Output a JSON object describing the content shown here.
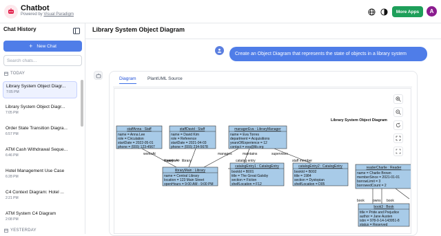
{
  "header": {
    "title": "Chatbot",
    "powered_prefix": "Powered by",
    "powered_brand": "Visual Paradigm",
    "more_apps": "More Apps",
    "avatar_letter": "A"
  },
  "sidebar": {
    "title": "Chat History",
    "new_chat": "New Chat",
    "search_placeholder": "Search chats...",
    "today_label": "TODAY",
    "yesterday_label": "YESTERDAY",
    "chats": [
      {
        "title": "Library System Object Diagr...",
        "time": "7:05 PM"
      },
      {
        "title": "Library System Object Diagr...",
        "time": "7:05 PM"
      },
      {
        "title": "Order State Transition Diagra...",
        "time": "6:57 PM"
      },
      {
        "title": "ATM Cash Withdrawal Seque...",
        "time": "6:46 PM"
      },
      {
        "title": "Hotel Management Use Case",
        "time": "6:28 PM"
      },
      {
        "title": "C4 Context Diagram: Hotel ...",
        "time": "2:21 PM"
      },
      {
        "title": "ATM System C4 Diagram",
        "time": "2:08 PM"
      }
    ]
  },
  "main": {
    "title": "Library System Object Diagram",
    "user_message": "Create an Object Diagram that represents the state of objects in a library system",
    "tabs": [
      "Diagram",
      "PlantUML Source"
    ]
  },
  "diagram": {
    "title": "Library System Object Diagram",
    "objects": [
      {
        "name": "staffAnna : Staff",
        "lines": [
          "name = Anna Lee",
          "role = Circulation",
          "startDate = 2022-05-01",
          "phone = (555) 123-4567"
        ]
      },
      {
        "name": "staffDavid : Staff",
        "lines": [
          "name = David Kim",
          "role = Reference",
          "startDate = 2021-04-03",
          "phone = (555) 234-5678"
        ]
      },
      {
        "name": "managerEva : LibraryManager",
        "lines": [
          "name = Eva Torres",
          "department = Acquisitions",
          "yearsOfExperience = 12",
          "contact = eva@lib.org"
        ]
      },
      {
        "name": "libraryMain : Library",
        "lines": [
          "name = Central Library",
          "location = 123 Main Street",
          "openHours = 9:00 AM - 9:00 PM"
        ]
      },
      {
        "name": "catalogEntry1 : CatalogEntry",
        "lines": [
          "bookId = B001",
          "title = The Great Gatsby",
          "section = Fiction",
          "shelfLocation = F12"
        ]
      },
      {
        "name": "catalogEntry2 : CatalogEntry",
        "lines": [
          "bookId = B002",
          "title = 1984",
          "section = Dystopian",
          "shelfLocation = D05"
        ]
      },
      {
        "name": "readerCharlie : Reader",
        "lines": [
          "name = Charlie Brown",
          "memberSince = 2021-01-01",
          "borrowLimit = 3",
          "borrowedCount = 2"
        ]
      },
      {
        "name": "book3 : Book",
        "lines": [
          "title = Pride and Prejudice",
          "author = Jane Austen",
          "isbn = 978-0-14-143951-8",
          "status = Reserved"
        ]
      }
    ],
    "links": [
      "worksAt",
      "worksAt",
      "manages",
      "maintains",
      "supervises",
      "library",
      "library",
      "catalog entry",
      "staff member",
      "owns",
      "book",
      "book"
    ]
  }
}
